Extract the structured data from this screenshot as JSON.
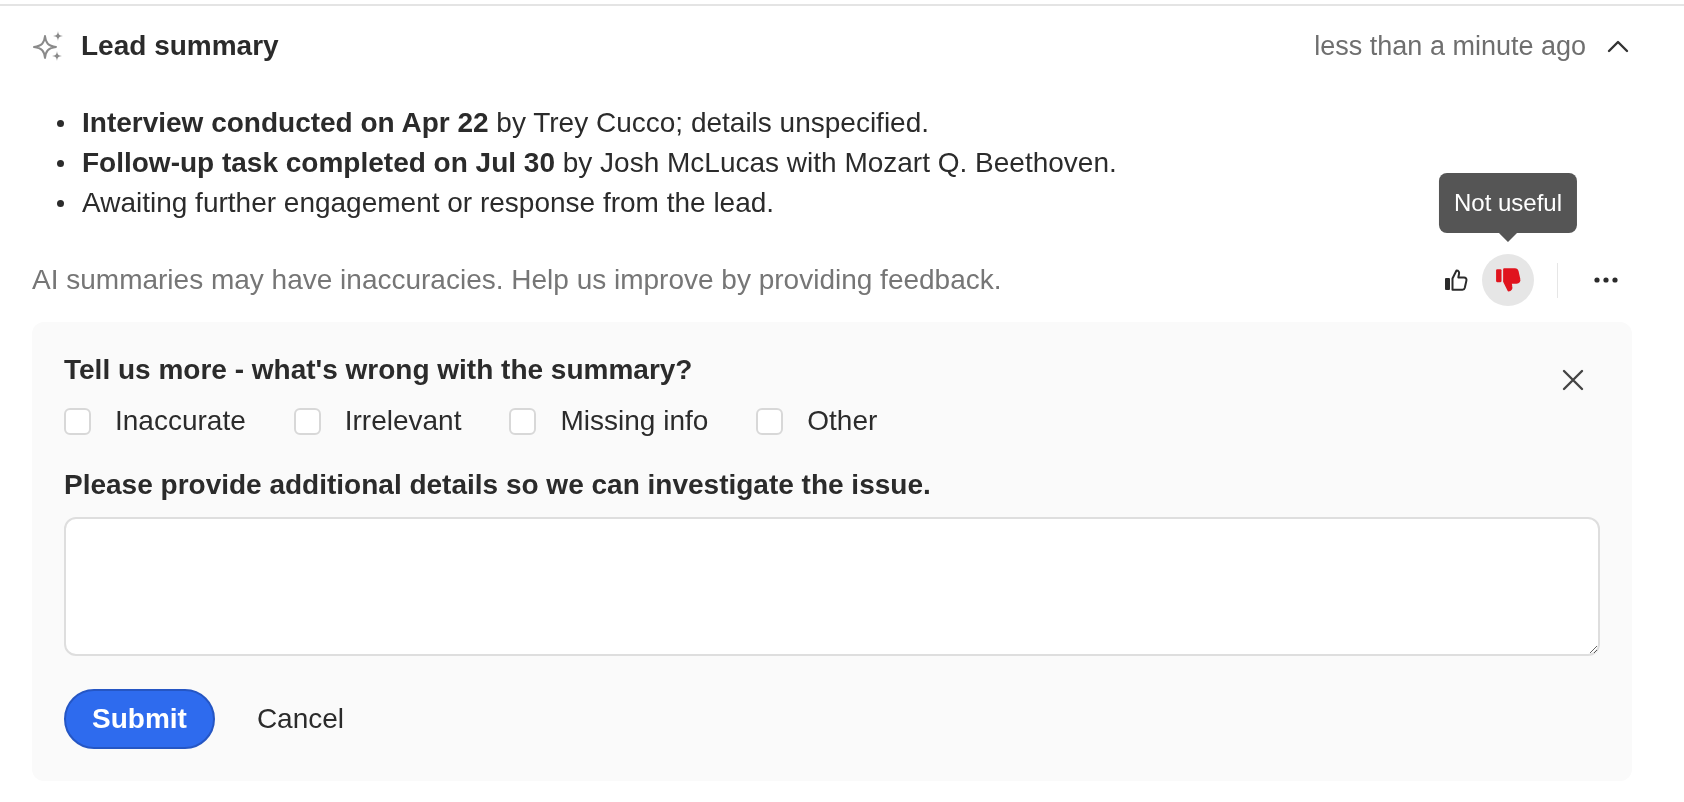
{
  "header": {
    "title": "Lead summary",
    "timestamp": "less than a minute ago",
    "expanded": true
  },
  "summary": {
    "bullets": [
      "**Interview conducted on Apr 22** by Trey Cucco; details unspecified.",
      "**Follow-up task completed on Jul 30** by Josh McLucas with Mozart Q. Beethoven.",
      "Awaiting further engagement or response from the lead."
    ]
  },
  "feedback_bar": {
    "disclaimer": "AI summaries may have inaccuracies. Help us improve by providing feedback.",
    "votes": [
      {
        "kind": "up",
        "selected": false
      },
      {
        "kind": "down",
        "selected": true,
        "tooltip": "Not useful"
      }
    ]
  },
  "feedback_form": {
    "heading": "Tell us more - what's wrong with the summary?",
    "options": [
      {
        "label": "Inaccurate",
        "checked": false
      },
      {
        "label": "Irrelevant",
        "checked": false
      },
      {
        "label": "Missing info",
        "checked": false
      },
      {
        "label": "Other",
        "checked": false
      }
    ],
    "details_label": "Please provide additional details so we can investigate the issue.",
    "buttons": [
      {
        "label": "Submit",
        "kind": "primary"
      },
      {
        "label": "Cancel",
        "kind": "plain"
      }
    ]
  }
}
